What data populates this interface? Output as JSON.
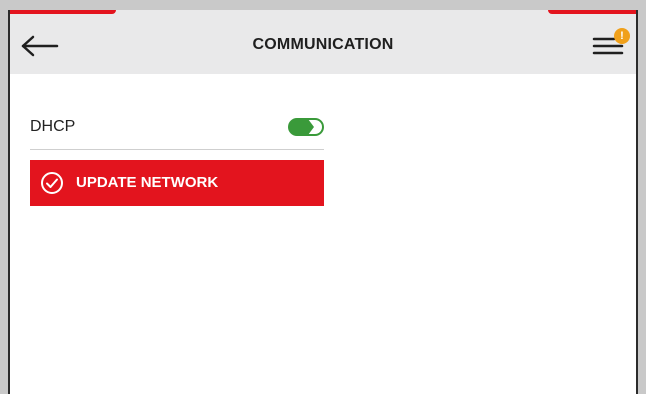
{
  "header": {
    "title": "COMMUNICATION",
    "back_icon": "arrow-left-icon",
    "menu_icon": "menu-icon",
    "notification_badge": "!"
  },
  "settings": {
    "dhcp_label": "DHCP",
    "dhcp_enabled": true,
    "update_button_label": "UPDATE NETWORK",
    "update_icon": "check-circle-icon"
  },
  "colors": {
    "accent": "#e3141e",
    "toggle_on": "#3a9a3a",
    "badge": "#f0a01a"
  }
}
